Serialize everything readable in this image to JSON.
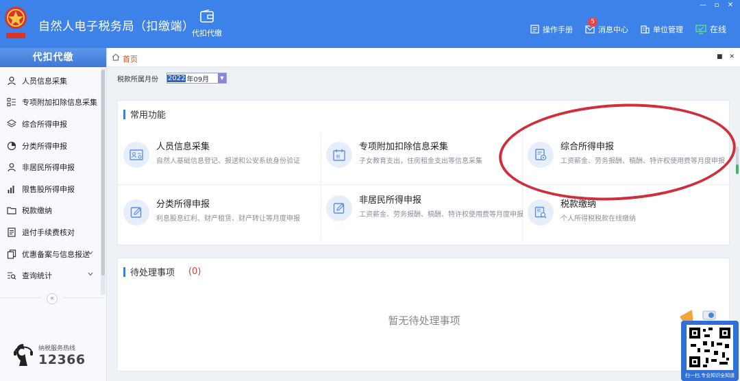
{
  "header": {
    "title": "自然人电子税务局（扣缴端）",
    "module": "代扣代缴",
    "actions": [
      {
        "label": "操作手册",
        "icon": "manual-icon"
      },
      {
        "label": "消息中心",
        "icon": "mail-icon",
        "badge": "5"
      },
      {
        "label": "单位管理",
        "icon": "building-icon"
      }
    ],
    "status": "在线",
    "accent": "#3c82e8"
  },
  "sidebar": {
    "title": "代扣代缴",
    "items": [
      {
        "label": "人员信息采集",
        "icon": "person-icon"
      },
      {
        "label": "专项附加扣除信息采集",
        "icon": "list-icon"
      },
      {
        "label": "综合所得申报",
        "icon": "layers-icon"
      },
      {
        "label": "分类所得申报",
        "icon": "pie-icon"
      },
      {
        "label": "非居民所得申报",
        "icon": "person-outline-icon"
      },
      {
        "label": "限售股所得申报",
        "icon": "bar-chart-icon"
      },
      {
        "label": "税款缴纳",
        "icon": "folder-icon"
      },
      {
        "label": "退付手续费核对",
        "icon": "document-icon"
      },
      {
        "label": "优惠备案与信息报送",
        "icon": "copy-icon"
      },
      {
        "label": "查询统计",
        "icon": "search-list-icon"
      }
    ],
    "hotline_label": "纳税服务热线",
    "hotline_number": "12366"
  },
  "main": {
    "breadcrumb": "首页",
    "filter": {
      "label": "税款所属月份",
      "year": "2022",
      "month_rest": "年09月"
    },
    "common": {
      "title": "常用功能",
      "cards": [
        {
          "name": "人员信息采集",
          "desc": "自然人基础信息登记、报送和公安系统身份验证"
        },
        {
          "name": "专项附加扣除信息采集",
          "desc": "子女教育支出，住房租金支出等信息采集"
        },
        {
          "name": "综合所得申报",
          "desc": "工资薪金、劳务报酬、稿酬、特许权使用费等月度申报"
        },
        {
          "name": "分类所得申报",
          "desc": "利息股息红利、财产租赁、财产转让等月度申报"
        },
        {
          "name": "非居民所得申报",
          "desc": "工资薪金、劳务报酬、稿酬、特许权使用费等月度申报"
        },
        {
          "name": "税款缴纳",
          "desc": "个人所得税税款在线缴纳"
        }
      ]
    },
    "pending": {
      "title": "待处理事项",
      "count": "(0)",
      "empty": "暂无待处理事项"
    }
  },
  "qr_widget": {
    "caption": "扫一扫,专业知识全知道"
  }
}
